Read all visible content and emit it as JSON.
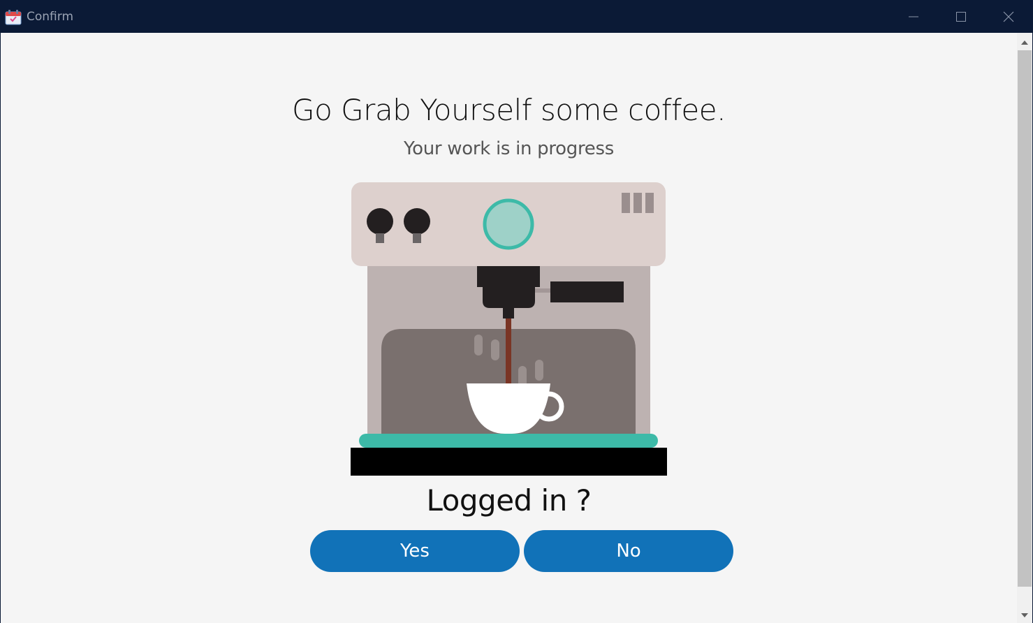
{
  "window": {
    "title": "Confirm",
    "icon": "calendar-app-icon",
    "controls": [
      "minimize-icon",
      "maximize-icon",
      "close-icon"
    ]
  },
  "main": {
    "headline": "Go Grab Yourself some coffee.",
    "subline": "Your work is in progress",
    "illustration": "coffee-machine-illustration",
    "question": "Logged in ?",
    "buttons": {
      "yes_label": "Yes",
      "no_label": "No"
    }
  },
  "colors": {
    "titlebar": "#0b1a36",
    "accent_button": "#1172b8",
    "teal": "#3dbaa8",
    "background": "#f5f5f5"
  }
}
